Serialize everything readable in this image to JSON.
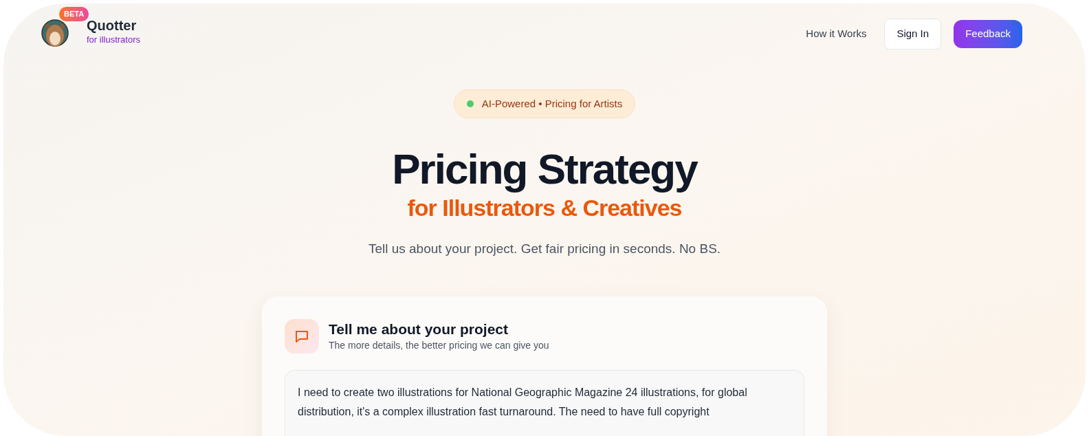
{
  "header": {
    "badge": "BETA",
    "brand": "Quotter",
    "tagline": "for illustrators",
    "nav": [
      {
        "label": "How it Works",
        "kind": "link"
      },
      {
        "label": "Sign In",
        "kind": "outline"
      },
      {
        "label": "Feedback",
        "kind": "primary"
      }
    ]
  },
  "hero": {
    "pill": "AI-Powered • Pricing for Artists",
    "title": "Pricing Strategy",
    "subtitle": "for Illustrators & Creatives",
    "lead": "Tell us about your project. Get fair pricing in seconds. No BS."
  },
  "card": {
    "title": "Tell me about your project",
    "subtitle": "The more details, the better pricing we can give you",
    "value": "I need to create two illustrations for National Geographic Magazine 24 illustrations, for global distribution, it's a complex illustration fast turnaround. The need to have full copyright"
  }
}
